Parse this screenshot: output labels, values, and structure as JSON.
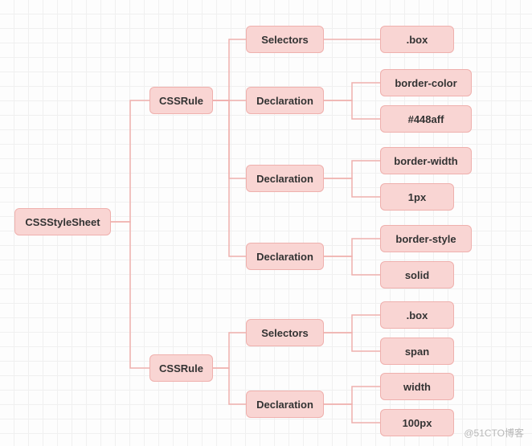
{
  "tree": {
    "root": "CSSStyleSheet",
    "rules": [
      {
        "label": "CSSRule",
        "children": [
          {
            "label": "Selectors",
            "values": [
              ".box"
            ]
          },
          {
            "label": "Declaration",
            "values": [
              "border-color",
              "#448aff"
            ]
          },
          {
            "label": "Declaration",
            "values": [
              "border-width",
              "1px"
            ]
          },
          {
            "label": "Declaration",
            "values": [
              "border-style",
              "solid"
            ]
          }
        ]
      },
      {
        "label": "CSSRule",
        "children": [
          {
            "label": "Selectors",
            "values": [
              ".box",
              "span"
            ]
          },
          {
            "label": "Declaration",
            "values": [
              "width",
              "100px"
            ]
          }
        ]
      }
    ]
  },
  "watermark": "@51CTO博客",
  "colors": {
    "node_bg": "#f9d5d3",
    "node_border": "#efb0ad",
    "connector": "#efb0ad"
  }
}
